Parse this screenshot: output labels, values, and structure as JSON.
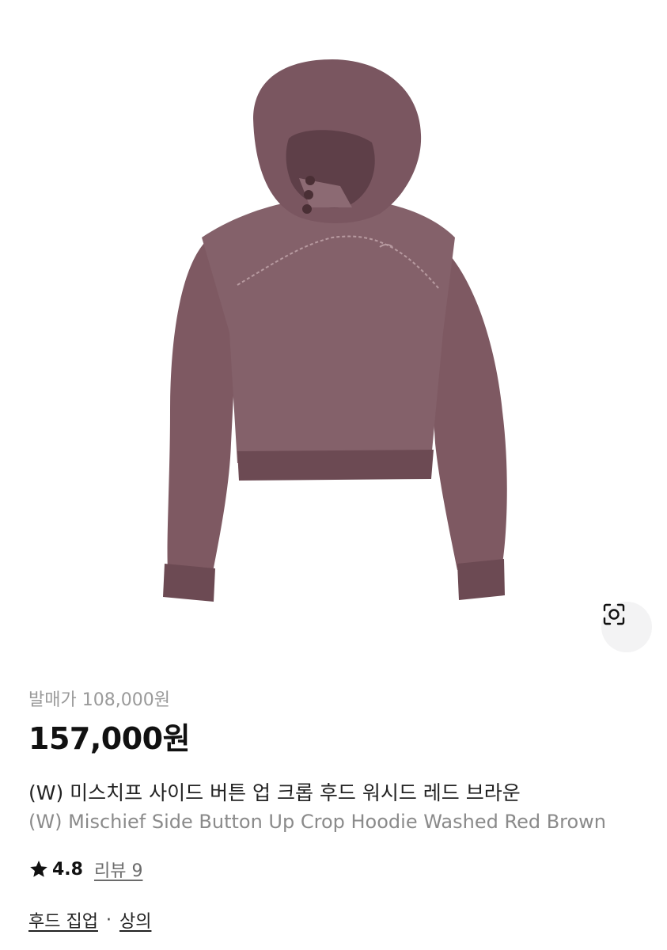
{
  "product": {
    "image_alt": "Washed red brown crop hoodie",
    "colors": {
      "hoodie": "#7e5962",
      "hoodie_shadow": "#5e3f48",
      "hoodie_highlight": "#9a7680",
      "stitch": "#b79aa0",
      "button": "#4a2f35"
    },
    "lens_icon": "image-search-icon",
    "release_price": "발매가 108,000원",
    "price": "157,000원",
    "title_ko": "(W) 미스치프 사이드 버튼 업 크롭 후드 워시드 레드 브라운",
    "title_en": "(W) Mischief Side Button Up Crop Hoodie Washed Red Brown",
    "rating": {
      "icon": "star-icon",
      "value": "4.8",
      "review_label": "리뷰 9"
    },
    "categories": [
      {
        "label": "후드 집업"
      },
      {
        "label": "상의"
      }
    ],
    "category_separator": "·"
  }
}
